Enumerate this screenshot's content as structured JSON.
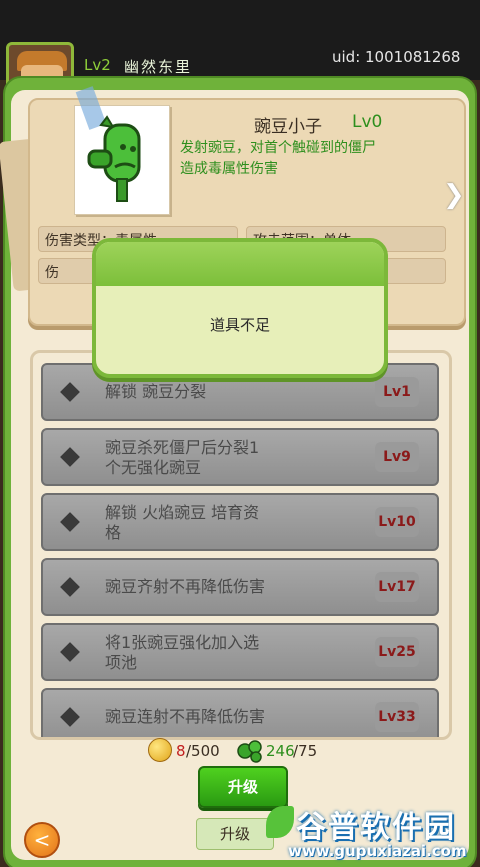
{
  "player": {
    "level_label": "Lv2",
    "name": "幽然东里",
    "uid": "uid: 1001081268"
  },
  "character": {
    "name": "豌豆小子",
    "level": "Lv0",
    "description_line1": "发射豌豆，对首个触碰到的僵尸",
    "description_line2": "造成毒属性伤害",
    "stats": {
      "row1_left": "伤害类型：毒属性",
      "row1_right": "攻击范围：单体",
      "row2_left": "伤"
    }
  },
  "skills": [
    {
      "line1": "解锁 豌豆分裂",
      "line2": "",
      "level": "Lv1"
    },
    {
      "line1": "豌豆杀死僵尸后分裂1",
      "line2": "个无强化豌豆",
      "level": "Lv9"
    },
    {
      "line1": "解锁 火焰豌豆 培育资",
      "line2": "格",
      "level": "Lv10"
    },
    {
      "line1": "豌豆齐射不再降低伤害",
      "line2": "",
      "level": "Lv17"
    },
    {
      "line1": "将1张豌豆强化加入选",
      "line2": "项池",
      "level": "Lv25"
    },
    {
      "line1": "豌豆连射不再降低伤害",
      "line2": "",
      "level": "Lv33"
    }
  ],
  "resources": {
    "coin_owned": "8",
    "coin_cost": "/500",
    "pea_owned": "246",
    "pea_cost": "/75"
  },
  "buttons": {
    "upgrade": "升级",
    "upgrade_tab": "升级",
    "back": "<"
  },
  "dialog": {
    "message": "道具不足"
  },
  "watermark": {
    "logo": "谷普软件园",
    "url": "www.gupuxiazai.com"
  },
  "colors": {
    "frame_green": "#6fb23a",
    "level_red": "#8b1a1a",
    "desc_green": "#2e8f1e"
  }
}
